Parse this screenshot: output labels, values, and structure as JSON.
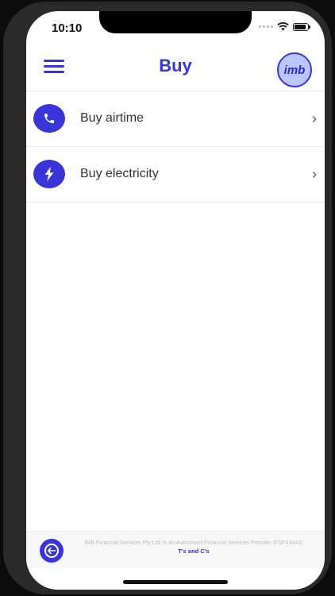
{
  "status_bar": {
    "time": "10:10"
  },
  "header": {
    "title": "Buy",
    "logo_text": "imb"
  },
  "menu": [
    {
      "label": "Buy airtime",
      "icon": "phone-icon"
    },
    {
      "label": "Buy electricity",
      "icon": "lightning-icon"
    }
  ],
  "footer": {
    "disclaimer": "IMB Financial Services Pty Ltd, is an Authorised Financial Services Provider (FSP43443)",
    "terms_label": "T's and C's"
  },
  "colors": {
    "accent": "#3a35d8",
    "logo_bg": "#b9c6ff"
  }
}
